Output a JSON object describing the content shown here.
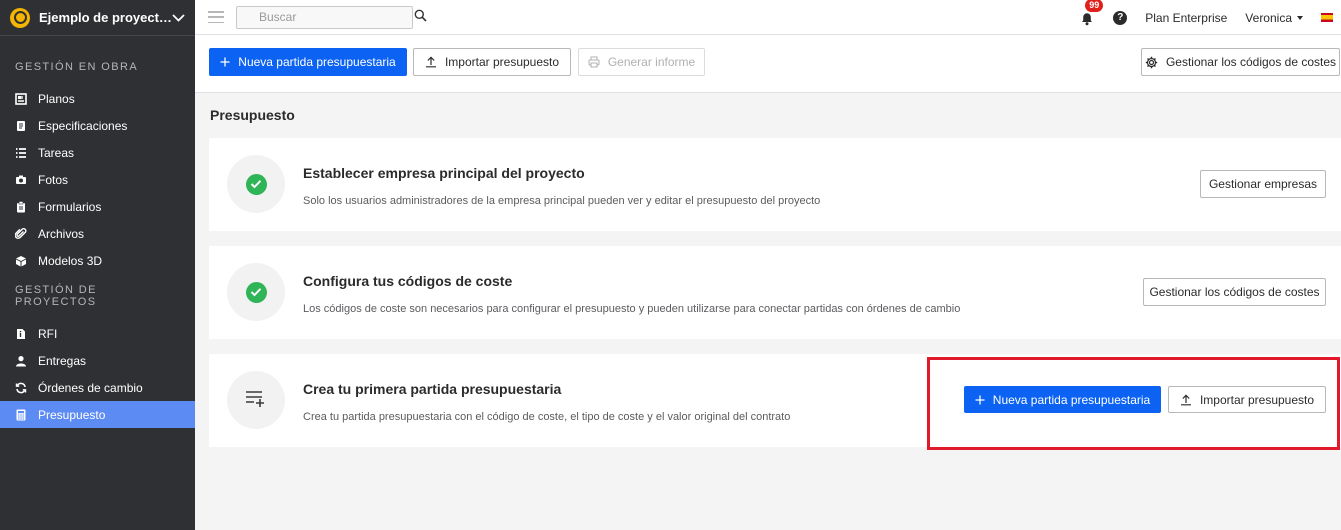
{
  "sidebar": {
    "project_name": "Ejemplo de proyect…",
    "sections": [
      {
        "title": "GESTIÓN EN OBRA",
        "items": [
          {
            "label": "Planos",
            "icon": "plans-icon"
          },
          {
            "label": "Especificaciones",
            "icon": "specifications-icon"
          },
          {
            "label": "Tareas",
            "icon": "tasks-icon"
          },
          {
            "label": "Fotos",
            "icon": "camera-icon"
          },
          {
            "label": "Formularios",
            "icon": "clipboard-icon"
          },
          {
            "label": "Archivos",
            "icon": "paperclip-icon"
          },
          {
            "label": "Modelos 3D",
            "icon": "cube-icon"
          }
        ]
      },
      {
        "title": "GESTIÓN DE PROYECTOS",
        "items": [
          {
            "label": "RFI",
            "icon": "rfi-icon"
          },
          {
            "label": "Entregas",
            "icon": "user-icon"
          },
          {
            "label": "Órdenes de cambio",
            "icon": "change-order-icon"
          },
          {
            "label": "Presupuesto",
            "icon": "calculator-icon",
            "active": true
          }
        ]
      }
    ]
  },
  "topbar": {
    "search_placeholder": "Buscar",
    "notifications_count": "99",
    "help_label": "?",
    "plan": "Plan Enterprise",
    "user": "Veronica"
  },
  "toolbar": {
    "new_item": "Nueva partida presupuestaria",
    "import": "Importar presupuesto",
    "report": "Generar informe",
    "manage_codes": "Gestionar los códigos de costes"
  },
  "main": {
    "title": "Presupuesto",
    "cards": [
      {
        "title": "Establecer empresa principal del proyecto",
        "description": "Solo los usuarios administradores de la empresa principal pueden ver y editar el presupuesto del proyecto",
        "status": "complete",
        "action": "Gestionar empresas"
      },
      {
        "title": "Configura tus códigos de coste",
        "description": "Los códigos de coste son necesarios para configurar el presupuesto y pueden utilizarse para conectar partidas con órdenes de cambio",
        "status": "complete",
        "action": "Gestionar los códigos de costes"
      },
      {
        "title": "Crea tu primera partida presupuestaria",
        "description": "Crea tu partida presupuestaria con el código de coste, el tipo de coste y el valor original del contrato",
        "status": "pending",
        "primary_action": "Nueva partida presupuestaria",
        "secondary_action": "Importar presupuesto"
      }
    ]
  },
  "colors": {
    "primary": "#0c62f3",
    "sidebar_bg": "#2f3033",
    "sidebar_active": "#5d8bf4",
    "success": "#2fb457",
    "highlight": "#e2182b",
    "badge": "#e0211b"
  }
}
